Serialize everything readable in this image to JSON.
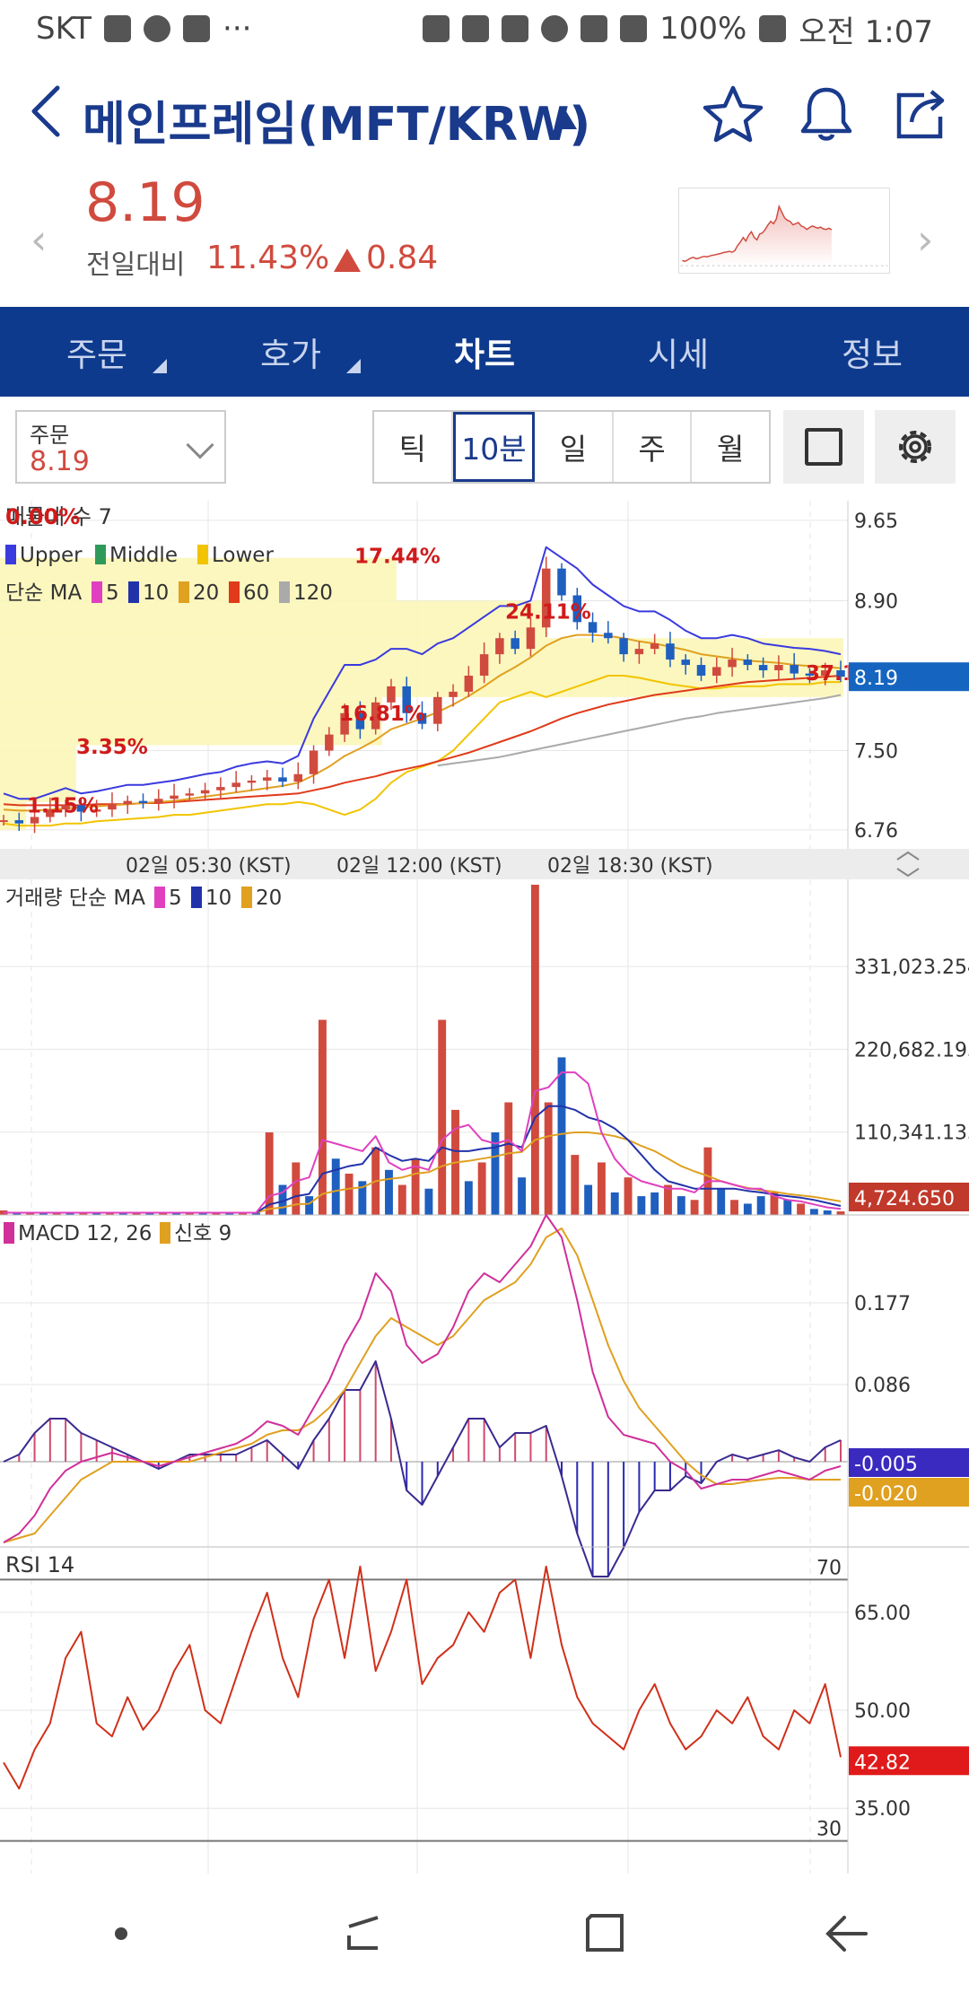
{
  "status_bar": {
    "carrier": "SKT",
    "battery": "100%",
    "time": "오전 1:07",
    "more": "···"
  },
  "header": {
    "title": "메인프레임(MFT/KRW)",
    "icons": [
      "back-arrow-icon",
      "star-icon",
      "bell-icon",
      "share-icon"
    ]
  },
  "price": {
    "current": "8.19",
    "change_label": "전일대비",
    "change_pct": "11.43%",
    "change_value": "0.84",
    "color_up": "#d04a3e"
  },
  "tabs": [
    {
      "label": "주문",
      "active": false,
      "has_menu": true
    },
    {
      "label": "호가",
      "active": false,
      "has_menu": true
    },
    {
      "label": "차트",
      "active": true,
      "has_menu": false
    },
    {
      "label": "시세",
      "active": false,
      "has_menu": false
    },
    {
      "label": "정보",
      "active": false,
      "has_menu": false
    }
  ],
  "controls": {
    "order_label": "주문",
    "order_value": "8.19",
    "intervals": [
      {
        "label": "틱",
        "active": false
      },
      {
        "label": "10분",
        "active": true
      },
      {
        "label": "일",
        "active": false
      },
      {
        "label": "주",
        "active": false
      },
      {
        "label": "월",
        "active": false
      }
    ]
  },
  "chart_data": [
    {
      "type": "line",
      "title": "매물대 수 7",
      "overlay_label": "0.00%",
      "legend": [
        {
          "name": "Upper",
          "color": "#3a3adf"
        },
        {
          "name": "Middle",
          "color": "#2e9a5a"
        },
        {
          "name": "Lower",
          "color": "#f2c400"
        }
      ],
      "ma_legend": {
        "label": "단순 MA",
        "items": [
          {
            "name": "5",
            "color": "#e040c0"
          },
          {
            "name": "10",
            "color": "#2233aa"
          },
          {
            "name": "20",
            "color": "#e0a020"
          },
          {
            "name": "60",
            "color": "#e03a1a"
          },
          {
            "name": "120",
            "color": "#aaaaaa"
          }
        ]
      },
      "y_ticks": [
        "9.65",
        "8.90",
        "7.50",
        "6.76"
      ],
      "y_tick_values": [
        9.65,
        8.9,
        7.5,
        6.76
      ],
      "ylim": [
        6.7,
        9.75
      ],
      "current_price": "8.19",
      "current_price_value": 8.19,
      "x_ticks": [
        "02일 05:30 (KST)",
        "02일 12:00 (KST)",
        "02일 18:30 (KST)"
      ],
      "volume_profile_labels": [
        {
          "label": "1.15%",
          "price": 6.92
        },
        {
          "label": "3.35%",
          "price": 7.47
        },
        {
          "label": "17.44%",
          "price": 9.25
        },
        {
          "label": "16.81%",
          "price": 7.78
        },
        {
          "label": "24.11%",
          "price": 8.73
        },
        {
          "label": "37.1",
          "price": 8.16
        }
      ],
      "close": [
        6.85,
        6.82,
        6.88,
        6.95,
        6.99,
        6.93,
        6.95,
        7.0,
        7.03,
        7.01,
        7.05,
        7.08,
        7.1,
        7.13,
        7.16,
        7.2,
        7.22,
        7.25,
        7.21,
        7.28,
        7.5,
        7.65,
        7.85,
        7.7,
        7.95,
        8.1,
        7.85,
        7.75,
        8.0,
        8.05,
        8.2,
        8.4,
        8.55,
        8.45,
        8.65,
        9.2,
        8.95,
        8.7,
        8.6,
        8.55,
        8.4,
        8.45,
        8.5,
        8.35,
        8.3,
        8.2,
        8.28,
        8.35,
        8.3,
        8.25,
        8.3,
        8.22,
        8.2,
        8.25,
        8.19
      ],
      "ma20": [
        6.95,
        6.94,
        6.94,
        6.95,
        6.96,
        6.97,
        6.98,
        6.99,
        7.0,
        7.01,
        7.02,
        7.03,
        7.05,
        7.07,
        7.09,
        7.11,
        7.13,
        7.15,
        7.17,
        7.2,
        7.27,
        7.35,
        7.45,
        7.52,
        7.6,
        7.7,
        7.75,
        7.8,
        7.86,
        7.93,
        8.01,
        8.1,
        8.2,
        8.28,
        8.37,
        8.48,
        8.55,
        8.58,
        8.58,
        8.57,
        8.55,
        8.52,
        8.5,
        8.47,
        8.44,
        8.4,
        8.38,
        8.36,
        8.34,
        8.33,
        8.32,
        8.3,
        8.29,
        8.28,
        8.27
      ],
      "ma60": [
        7.0,
        6.99,
        6.99,
        6.99,
        6.99,
        6.99,
        7.0,
        7.0,
        7.0,
        7.01,
        7.01,
        7.02,
        7.03,
        7.04,
        7.05,
        7.06,
        7.07,
        7.08,
        7.09,
        7.1,
        7.13,
        7.16,
        7.2,
        7.23,
        7.26,
        7.3,
        7.33,
        7.36,
        7.4,
        7.44,
        7.48,
        7.53,
        7.58,
        7.63,
        7.68,
        7.74,
        7.8,
        7.85,
        7.89,
        7.93,
        7.96,
        7.99,
        8.02,
        8.04,
        8.06,
        8.08,
        8.1,
        8.12,
        8.14,
        8.15,
        8.16,
        8.17,
        8.18,
        8.19,
        8.2
      ],
      "ma120": [
        null,
        null,
        null,
        null,
        null,
        null,
        null,
        null,
        null,
        null,
        null,
        null,
        null,
        null,
        null,
        null,
        null,
        null,
        null,
        null,
        null,
        null,
        null,
        null,
        null,
        null,
        null,
        null,
        7.36,
        7.38,
        7.4,
        7.42,
        7.44,
        7.47,
        7.5,
        7.53,
        7.56,
        7.59,
        7.62,
        7.65,
        7.68,
        7.71,
        7.74,
        7.77,
        7.8,
        7.82,
        7.85,
        7.87,
        7.89,
        7.91,
        7.93,
        7.95,
        7.97,
        7.99,
        8.02
      ],
      "upper": [
        7.1,
        7.05,
        7.05,
        7.1,
        7.15,
        7.1,
        7.12,
        7.15,
        7.18,
        7.18,
        7.2,
        7.22,
        7.25,
        7.28,
        7.3,
        7.35,
        7.38,
        7.4,
        7.38,
        7.45,
        7.8,
        8.05,
        8.3,
        8.3,
        8.35,
        8.45,
        8.45,
        8.4,
        8.5,
        8.55,
        8.65,
        8.75,
        8.85,
        8.85,
        8.9,
        9.4,
        9.3,
        9.2,
        9.05,
        8.95,
        8.85,
        8.8,
        8.8,
        8.72,
        8.62,
        8.55,
        8.55,
        8.58,
        8.55,
        8.5,
        8.48,
        8.46,
        8.45,
        8.43,
        8.4
      ],
      "lower": [
        6.82,
        6.8,
        6.8,
        6.8,
        6.82,
        6.82,
        6.84,
        6.85,
        6.86,
        6.87,
        6.88,
        6.9,
        6.9,
        6.92,
        6.94,
        6.96,
        6.98,
        7.0,
        7.0,
        7.02,
        7.0,
        6.95,
        6.9,
        6.95,
        7.05,
        7.2,
        7.3,
        7.35,
        7.4,
        7.5,
        7.65,
        7.8,
        7.95,
        8.0,
        8.05,
        8.0,
        8.05,
        8.1,
        8.15,
        8.2,
        8.2,
        8.18,
        8.15,
        8.12,
        8.1,
        8.08,
        8.08,
        8.1,
        8.1,
        8.1,
        8.12,
        8.12,
        8.12,
        8.14,
        8.14
      ]
    },
    {
      "type": "bar",
      "title": "거래량",
      "ma_legend": {
        "label": "단순 MA",
        "items": [
          {
            "name": "5",
            "color": "#e040c0"
          },
          {
            "name": "10",
            "color": "#2233aa"
          },
          {
            "name": "20",
            "color": "#e0a020"
          }
        ]
      },
      "y_ticks": [
        "331,023.254",
        "220,682.193",
        "110,341.133"
      ],
      "y_tick_values": [
        331023.254,
        220682.193,
        110341.133
      ],
      "ylim": [
        0,
        440000
      ],
      "current_value": "4,724.650",
      "current_value_num": 4724.65,
      "values": [
        6000,
        3000,
        2000,
        2500,
        3000,
        2000,
        2500,
        2000,
        3000,
        2500,
        2000,
        3500,
        2000,
        3000,
        2500,
        2000,
        4000,
        3000,
        2500,
        3500,
        110000,
        40000,
        70000,
        25000,
        260000,
        75000,
        55000,
        45000,
        90000,
        60000,
        40000,
        75000,
        35000,
        260000,
        140000,
        45000,
        70000,
        110000,
        150000,
        50000,
        440000,
        150000,
        210000,
        80000,
        40000,
        70000,
        30000,
        50000,
        25000,
        30000,
        40000,
        25000,
        20000,
        90000,
        35000,
        20000,
        15000,
        25000,
        30000,
        20000,
        15000,
        8000,
        6000,
        4724
      ],
      "up": [
        true,
        false,
        true,
        false,
        true,
        false,
        true,
        false,
        true,
        false,
        true,
        false,
        true,
        false,
        true,
        false,
        true,
        false,
        true,
        false,
        true,
        false,
        true,
        false,
        true,
        false,
        true,
        false,
        true,
        false,
        true,
        true,
        false,
        true,
        true,
        false,
        true,
        false,
        true,
        false,
        true,
        true,
        false,
        true,
        false,
        true,
        false,
        true,
        false,
        false,
        true,
        false,
        true,
        true,
        false,
        true,
        false,
        false,
        true,
        false,
        true,
        false,
        false,
        true
      ],
      "ma5": [
        3000,
        3000,
        3000,
        3000,
        3000,
        3000,
        3000,
        3000,
        3000,
        3000,
        3000,
        3000,
        3000,
        3000,
        3000,
        3000,
        3000,
        3000,
        3000,
        3000,
        25000,
        30000,
        45000,
        50000,
        100000,
        95000,
        90000,
        85000,
        105000,
        70000,
        60000,
        65000,
        60000,
        100000,
        115000,
        120000,
        100000,
        95000,
        100000,
        85000,
        165000,
        170000,
        190000,
        190000,
        175000,
        110000,
        75000,
        55000,
        45000,
        40000,
        35000,
        35000,
        30000,
        45000,
        45000,
        40000,
        35000,
        35000,
        25000,
        20000,
        18000,
        14000,
        10000,
        8000
      ],
      "ma10": [
        3000,
        3000,
        3000,
        3000,
        3000,
        3000,
        3000,
        3000,
        3000,
        3000,
        3000,
        3000,
        3000,
        3000,
        3000,
        3000,
        3000,
        3000,
        3000,
        3000,
        14000,
        18000,
        25000,
        28000,
        55000,
        60000,
        65000,
        68000,
        90000,
        80000,
        72000,
        75000,
        72000,
        90000,
        85000,
        85000,
        88000,
        90000,
        95000,
        90000,
        130000,
        145000,
        145000,
        140000,
        130000,
        125000,
        115000,
        100000,
        80000,
        60000,
        45000,
        40000,
        35000,
        35000,
        35000,
        35000,
        32000,
        30000,
        27000,
        25000,
        23000,
        20000,
        16000,
        12000
      ],
      "ma20": [
        3000,
        3000,
        3000,
        3000,
        3000,
        3000,
        3000,
        3000,
        3000,
        3000,
        3000,
        3000,
        3000,
        3000,
        3000,
        3000,
        3000,
        3000,
        3000,
        3000,
        8000,
        10000,
        14000,
        15000,
        28000,
        32000,
        35000,
        37000,
        45000,
        48000,
        50000,
        55000,
        57000,
        65000,
        70000,
        72000,
        75000,
        78000,
        82000,
        84000,
        100000,
        105000,
        108000,
        110000,
        110000,
        108000,
        105000,
        100000,
        92000,
        85000,
        75000,
        65000,
        58000,
        52000,
        45000,
        40000,
        36000,
        33000,
        31000,
        28000,
        26000,
        24000,
        21000,
        18000
      ]
    },
    {
      "type": "line",
      "title": "MACD 12, 26",
      "signal_label": "신호 9",
      "legend": [
        {
          "name": "MACD 12, 26",
          "color": "#d0309a"
        },
        {
          "name": "신호 9",
          "color": "#e0a020"
        }
      ],
      "y_ticks": [
        "0.177",
        "0.086"
      ],
      "y_tick_values": [
        0.177,
        0.086
      ],
      "ylim": [
        -0.095,
        0.275
      ],
      "current_macd": "-0.005",
      "current_macd_value": -0.005,
      "current_signal": "-0.020",
      "current_signal_value": -0.02,
      "macd": [
        -0.09,
        -0.08,
        -0.06,
        -0.03,
        -0.01,
        0.0,
        0.005,
        0.01,
        0.005,
        0.0,
        -0.005,
        0.0,
        0.005,
        0.01,
        0.015,
        0.02,
        0.03,
        0.045,
        0.04,
        0.03,
        0.06,
        0.09,
        0.13,
        0.16,
        0.21,
        0.19,
        0.13,
        0.11,
        0.12,
        0.15,
        0.19,
        0.21,
        0.2,
        0.22,
        0.24,
        0.275,
        0.25,
        0.18,
        0.1,
        0.05,
        0.03,
        0.025,
        0.02,
        0.0,
        -0.01,
        -0.03,
        -0.025,
        -0.02,
        -0.02,
        -0.015,
        -0.01,
        -0.015,
        -0.02,
        -0.01,
        -0.005
      ],
      "signal": [
        -0.09,
        -0.085,
        -0.08,
        -0.06,
        -0.04,
        -0.02,
        -0.01,
        0.0,
        0.0,
        0.0,
        0.0,
        0.0,
        0.0,
        0.005,
        0.01,
        0.015,
        0.02,
        0.03,
        0.035,
        0.035,
        0.045,
        0.06,
        0.08,
        0.11,
        0.14,
        0.16,
        0.15,
        0.14,
        0.13,
        0.14,
        0.16,
        0.18,
        0.19,
        0.2,
        0.22,
        0.25,
        0.26,
        0.23,
        0.18,
        0.13,
        0.09,
        0.06,
        0.04,
        0.02,
        0.0,
        -0.015,
        -0.025,
        -0.025,
        -0.022,
        -0.02,
        -0.018,
        -0.018,
        -0.02,
        -0.02,
        -0.02
      ]
    },
    {
      "type": "line",
      "title": "RSI 14",
      "y_ticks": [
        "65.00",
        "50.00",
        "35.00"
      ],
      "y_tick_values": [
        65,
        50,
        35
      ],
      "bands": [
        "70",
        "30"
      ],
      "band_values": [
        70,
        30
      ],
      "ylim": [
        25,
        75
      ],
      "current_value": "42.82",
      "current_value_num": 42.82,
      "values": [
        42,
        38,
        44,
        48,
        58,
        62,
        48,
        46,
        52,
        47,
        50,
        56,
        60,
        50,
        48,
        55,
        62,
        68,
        58,
        52,
        64,
        70,
        58,
        72,
        56,
        62,
        70,
        54,
        58,
        60,
        65,
        62,
        68,
        70,
        58,
        72,
        60,
        52,
        48,
        46,
        44,
        50,
        54,
        48,
        44,
        46,
        50,
        48,
        52,
        46,
        44,
        50,
        48,
        54,
        42.82
      ]
    }
  ]
}
